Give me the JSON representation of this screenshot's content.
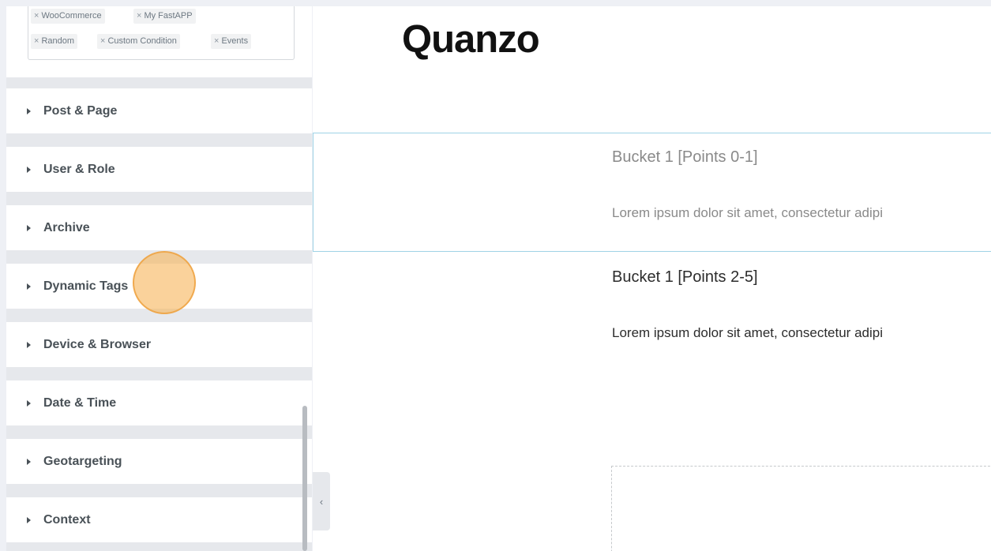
{
  "panel": {
    "tags": [
      {
        "label": "WooCommerce"
      },
      {
        "label": "My FastAPP"
      },
      {
        "label": "Random"
      },
      {
        "label": "Custom Condition"
      },
      {
        "label": "Events"
      }
    ],
    "tag_remove_glyph": "×",
    "sections": [
      {
        "label": "Post & Page"
      },
      {
        "label": "User & Role"
      },
      {
        "label": "Archive"
      },
      {
        "label": "Dynamic Tags"
      },
      {
        "label": "Device & Browser"
      },
      {
        "label": "Date & Time"
      },
      {
        "label": "Geotargeting"
      },
      {
        "label": "Context"
      }
    ],
    "collapse_glyph": "‹"
  },
  "preview": {
    "logo": "Quanzo",
    "buckets": [
      {
        "title": "Bucket 1 [Points 0-1]",
        "text": "Lorem ipsum dolor sit amet, consectetur adipi"
      },
      {
        "title": "Bucket 1 [Points 2-5]",
        "text": "Lorem ipsum dolor sit amet, consectetur adipi"
      }
    ]
  },
  "colors": {
    "accent_outline": "#9fd3e6",
    "click_marker": "#f7b458"
  }
}
